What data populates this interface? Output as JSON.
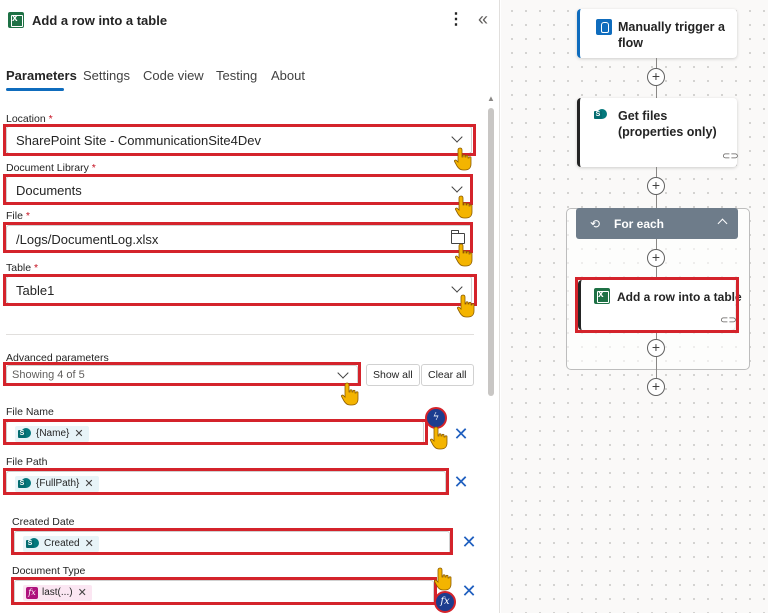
{
  "panel": {
    "title": "Add a row into a table",
    "tabs": [
      {
        "label": "Parameters",
        "active": true
      },
      {
        "label": "Settings"
      },
      {
        "label": "Code view"
      },
      {
        "label": "Testing"
      },
      {
        "label": "About"
      }
    ],
    "fields": {
      "location": {
        "label": "Location",
        "required": "*",
        "value": "SharePoint Site - CommunicationSite4Dev"
      },
      "library": {
        "label": "Document Library",
        "required": "*",
        "value": "Documents"
      },
      "file": {
        "label": "File",
        "required": "*",
        "value": "/Logs/DocumentLog.xlsx"
      },
      "table": {
        "label": "Table",
        "required": "*",
        "value": "Table1"
      }
    },
    "advanced": {
      "label": "Advanced parameters",
      "selected": "Showing 4 of 5",
      "show_all": "Show all",
      "clear_all": "Clear all"
    },
    "params": {
      "file_name": {
        "label": "File Name",
        "token": "{Name}"
      },
      "file_path": {
        "label": "File Path",
        "token": "{FullPath}"
      },
      "created_date": {
        "label": "Created Date",
        "token": "Created"
      },
      "document_type": {
        "label": "Document Type",
        "token": "last(...)"
      }
    },
    "token_remove": "✕",
    "field_clear": "✕",
    "fx_glyph": "fx"
  },
  "flow": {
    "trigger": {
      "title": "Manually trigger a flow"
    },
    "get_files": {
      "title": "Get files (properties only)"
    },
    "foreach": {
      "title": "For each"
    },
    "add_row": {
      "title": "Add a row into a table"
    },
    "add_step": "+"
  },
  "colors": {
    "accent": "#0f6cbd",
    "highlight": "#d4232b",
    "excel": "#1e7145",
    "sharepoint": "#03787c",
    "expression": "#ae117c"
  },
  "icons": {
    "excel": "excel-icon",
    "more": "more-vertical-icon",
    "collapse": "double-chevron-left-icon",
    "dropdown": "chevron-down-icon",
    "folder": "folder-icon",
    "sharepoint": "sharepoint-icon",
    "expression": "fx-icon",
    "pointer": "pointing-hand-icon"
  }
}
